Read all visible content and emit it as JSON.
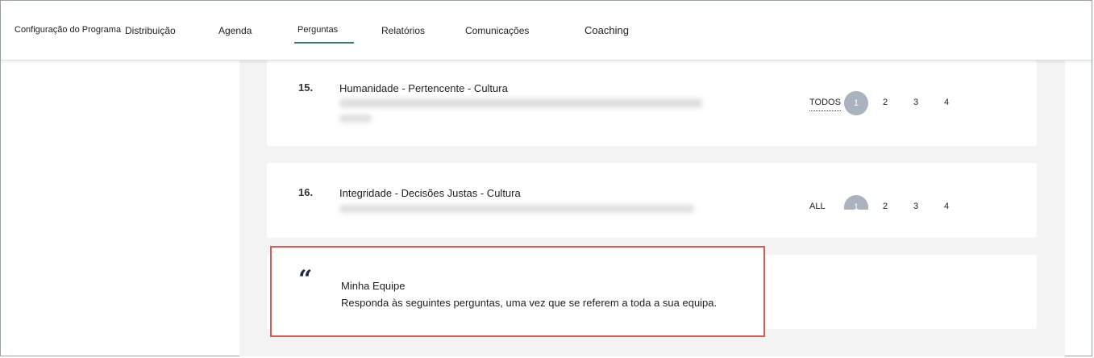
{
  "nav": {
    "items": [
      {
        "label": "Configuração do Programa"
      },
      {
        "label": "Distribuição"
      },
      {
        "label": "Agenda"
      },
      {
        "label": "Perguntas"
      },
      {
        "label": "Relatórios"
      },
      {
        "label": "Comunicações"
      },
      {
        "label": "Coaching"
      }
    ],
    "active": "Perguntas"
  },
  "questions": [
    {
      "number": "15.",
      "title": "Humanidade - Pertencente - Cultura",
      "scale": {
        "all_label": "TODOS",
        "selected": "1",
        "options": [
          "2",
          "3",
          "4"
        ]
      }
    },
    {
      "number": "16.",
      "title": "Integridade - Decisões Justas - Cultura",
      "scale": {
        "all_label": "ALL",
        "selected": "1",
        "options": [
          "2",
          "3",
          "4"
        ]
      }
    }
  ],
  "section": {
    "icon": "quote-icon",
    "title": "Minha Equipe",
    "description": "Responda às seguintes perguntas, uma vez que se referem a toda a sua equipa."
  },
  "colors": {
    "accent": "#2f7d75",
    "highlight_border": "#e05a4f",
    "selected_circle": "#a9b2bd",
    "content_bg": "#f3f3f3"
  }
}
